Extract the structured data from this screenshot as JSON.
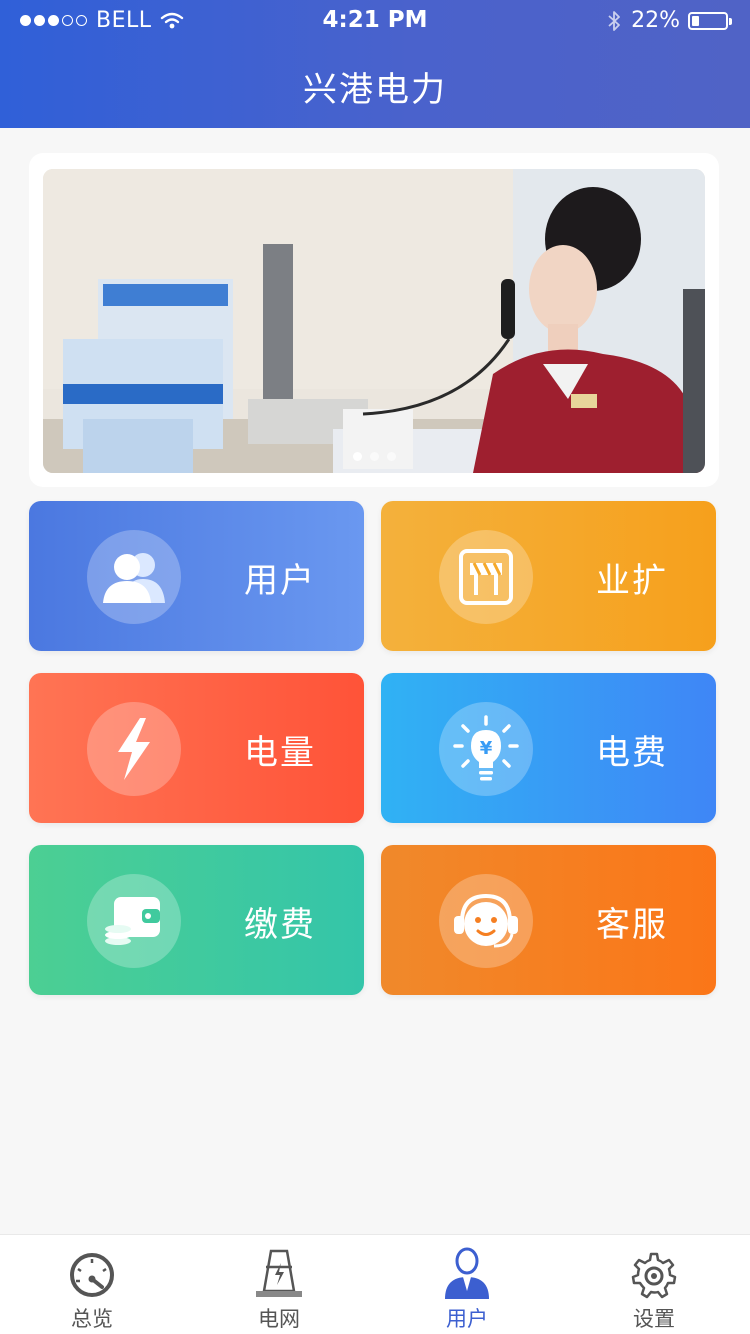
{
  "status_bar": {
    "carrier": "BELL",
    "signal_dots_filled": 3,
    "signal_dots_total": 5,
    "time": "4:21 PM",
    "battery_percent": "22%",
    "battery_level": 0.22
  },
  "header": {
    "title": "兴港电力"
  },
  "banner": {
    "slide_count": 3,
    "active_index": 0
  },
  "tiles": [
    {
      "label": "用户",
      "icon": "users-icon"
    },
    {
      "label": "业扩",
      "icon": "expansion-icon"
    },
    {
      "label": "电量",
      "icon": "lightning-icon"
    },
    {
      "label": "电费",
      "icon": "bulb-yen-icon"
    },
    {
      "label": "缴费",
      "icon": "wallet-icon"
    },
    {
      "label": "客服",
      "icon": "headset-icon"
    }
  ],
  "tabbar": {
    "active_index": 2,
    "items": [
      {
        "label": "总览",
        "icon": "gauge-icon"
      },
      {
        "label": "电网",
        "icon": "tower-icon"
      },
      {
        "label": "用户",
        "icon": "user-icon"
      },
      {
        "label": "设置",
        "icon": "gear-icon"
      }
    ]
  },
  "colors": {
    "header": "#3f62d2",
    "active_tab": "#3c5fd0",
    "tile_user": "#5a86e8",
    "tile_expand": "#f5a92a",
    "tile_power": "#ff6446",
    "tile_fee": "#389cf5",
    "tile_pay": "#40ca9e",
    "tile_service": "#f57f22"
  }
}
